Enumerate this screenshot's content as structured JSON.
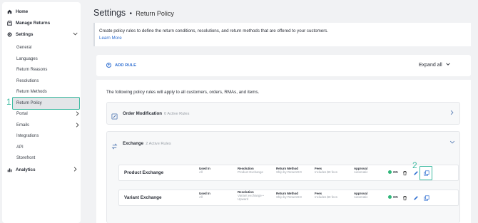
{
  "sidebar": {
    "home": "Home",
    "manage_returns": "Manage Returns",
    "settings": "Settings",
    "settings_items": [
      "General",
      "Languages",
      "Return Reasons",
      "Resolutions",
      "Return Methods",
      "Return Policy",
      "Portal",
      "Emails",
      "Integrations",
      "API",
      "Storefront"
    ],
    "analytics": "Analytics",
    "active_item": "Return Policy"
  },
  "annotations": {
    "callout_1": "1",
    "callout_2": "2",
    "highlight_color": "#3fbba2"
  },
  "header": {
    "title": "Settings",
    "separator": "•",
    "subtitle": "Return Policy"
  },
  "info": {
    "text": "Create policy rules to define the return conditions, resolutions, and return methods that are offered to your customers.",
    "link": "Learn More"
  },
  "toolbar": {
    "add_rule": "ADD RULE",
    "expand_all": "Expand all"
  },
  "main": {
    "rules_note": "The following policy rules will apply to all customers, orders, RMAs, and items.",
    "groups": [
      {
        "title": "Order Modification",
        "count": "0 Active Rules",
        "expanded": false
      },
      {
        "title": "Exchange",
        "count": "2 Active Rules",
        "expanded": true
      }
    ],
    "rules": [
      {
        "name": "Product Exchange",
        "used_in_label": "Used In",
        "used_in": "All",
        "resolution_label": "Resolution",
        "resolution": "Product Exchange",
        "method_label": "Return Method",
        "method": "Ship by ReturnGO",
        "fees_label": "Fees",
        "fees": "Includes $0 fees",
        "approval_label": "Approval",
        "approval": "Automatic",
        "status": "ON"
      },
      {
        "name": "Variant Exchange",
        "used_in_label": "Used In",
        "used_in": "All",
        "resolution_label": "Resolution",
        "resolution": "Variant exchange • Upward",
        "method_label": "Return Method",
        "method": "Ship by ReturnGO",
        "fees_label": "Fees",
        "fees": "Includes $0 fees",
        "approval_label": "Approval",
        "approval": "Automatic",
        "status": "ON"
      }
    ]
  },
  "colors": {
    "accent": "#2f6fd1",
    "status_on": "#2fb679",
    "annotation": "#3fbba2"
  }
}
